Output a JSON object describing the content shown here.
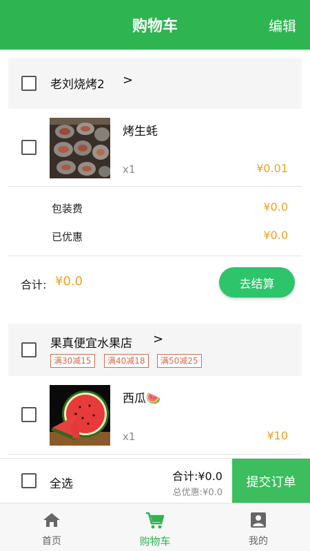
{
  "header": {
    "title": "购物车",
    "edit_label": "编辑"
  },
  "colors": {
    "brand": "#2eb451",
    "price": "#f0a020",
    "promo": "#d46a4a"
  },
  "shops": [
    {
      "name": "老刘烧烤2",
      "chevron": ">",
      "items": [
        {
          "name": "烤生蚝",
          "qty": "x1",
          "price": "¥0.01"
        }
      ],
      "fees": [
        {
          "label": "包装费",
          "value": "¥0.0"
        },
        {
          "label": "已优惠",
          "value": "¥0.0"
        }
      ],
      "subtotal_label": "合计:",
      "subtotal_value": "¥0.0",
      "checkout_label": "去结算"
    },
    {
      "name": "果真便宜水果店",
      "chevron": ">",
      "promos": [
        "满30减15",
        "满40减18",
        "满50减25"
      ],
      "items": [
        {
          "name": "西瓜🍉",
          "qty": "x1",
          "price": "¥10"
        }
      ]
    }
  ],
  "footer": {
    "select_all_label": "全选",
    "total": "合计:¥0.0",
    "total_discount": "总优惠:¥0.0",
    "submit_label": "提交订单"
  },
  "tabs": [
    {
      "label": "首页",
      "icon": "home-icon",
      "active": false
    },
    {
      "label": "购物车",
      "icon": "cart-icon",
      "active": true
    },
    {
      "label": "我的",
      "icon": "profile-icon",
      "active": false
    }
  ]
}
